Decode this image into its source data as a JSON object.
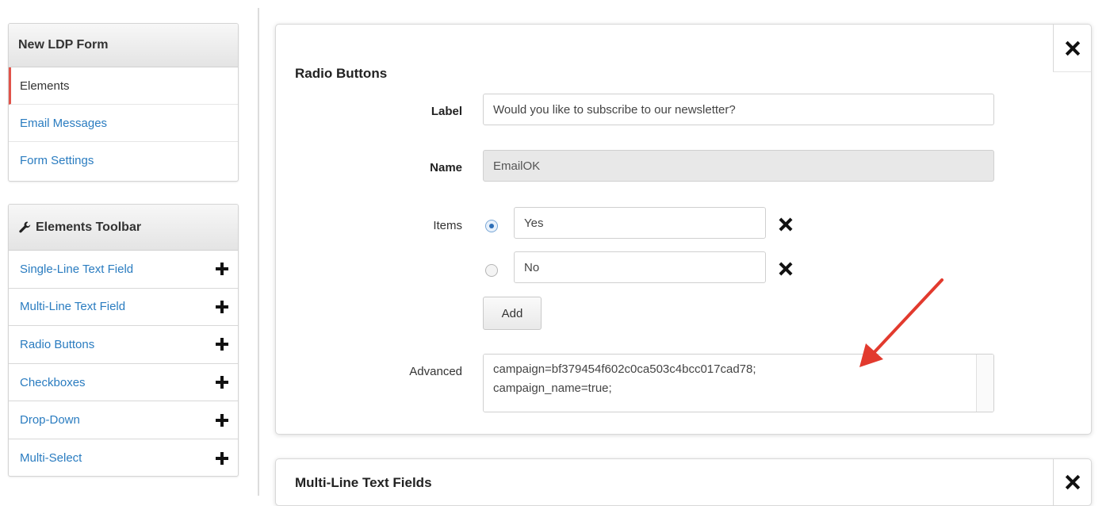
{
  "form_panel": {
    "title": "New LDP Form",
    "items": [
      {
        "label": "Elements",
        "active": true
      },
      {
        "label": "Email Messages",
        "active": false
      },
      {
        "label": "Form Settings",
        "active": false
      }
    ]
  },
  "toolbar_panel": {
    "title": "Elements Toolbar",
    "title_icon": "wrench-icon",
    "items": [
      {
        "label": "Single-Line Text Field",
        "icon": "plus-icon"
      },
      {
        "label": "Multi-Line Text Field",
        "icon": "plus-icon"
      },
      {
        "label": "Radio Buttons",
        "icon": "plus-icon"
      },
      {
        "label": "Checkboxes",
        "icon": "plus-icon"
      },
      {
        "label": "Drop-Down",
        "icon": "plus-icon"
      },
      {
        "label": "Multi-Select",
        "icon": "plus-icon"
      }
    ]
  },
  "radio_card": {
    "title": "Radio Buttons",
    "close_icon": "close-icon",
    "label_field": {
      "label": "Label",
      "value": "Would you like to subscribe to our newsletter?"
    },
    "name_field": {
      "label": "Name",
      "value": "EmailOK"
    },
    "items_label": "Items",
    "items": [
      {
        "value": "Yes",
        "checked": true
      },
      {
        "value": "No",
        "checked": false
      }
    ],
    "add_label": "Add",
    "advanced": {
      "label": "Advanced",
      "value": "campaign=bf379454f602c0ca503c4bcc017cad78;\ncampaign_name=true;"
    }
  },
  "multiline_card": {
    "title": "Multi-Line Text Fields",
    "close_icon": "close-icon"
  },
  "colors": {
    "link": "#2a7cc0",
    "active_marker": "#e0534a",
    "annotation_arrow": "#e23a2e"
  }
}
